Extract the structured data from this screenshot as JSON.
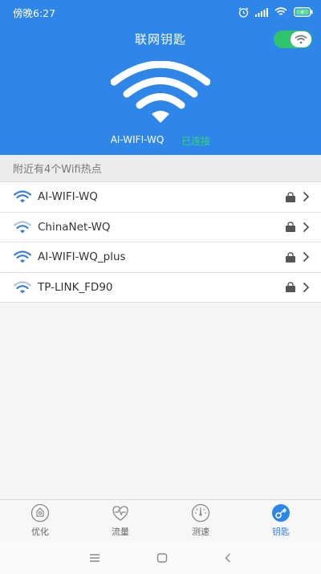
{
  "statusbar": {
    "time": "傍晚6:27"
  },
  "header": {
    "title": "联网钥匙",
    "toggle_on": true,
    "connected_ssid": "AI-WIFI-WQ",
    "connected_status": "已连接"
  },
  "section": {
    "title": "附近有4个Wifi热点"
  },
  "networks": [
    {
      "name": "AI-WIFI-WQ",
      "signal": "strong",
      "locked": true
    },
    {
      "name": "ChinaNet-WQ",
      "signal": "medium",
      "locked": true
    },
    {
      "name": "AI-WIFI-WQ_plus",
      "signal": "strong",
      "locked": true
    },
    {
      "name": "TP-LINK_FD90",
      "signal": "medium",
      "locked": true
    }
  ],
  "bottom_nav": [
    {
      "label": "优化",
      "icon": "optimize-icon",
      "active": false
    },
    {
      "label": "流量",
      "icon": "traffic-icon",
      "active": false
    },
    {
      "label": "测速",
      "icon": "speedometer-icon",
      "active": false
    },
    {
      "label": "钥匙",
      "icon": "key-icon",
      "active": true
    }
  ],
  "colors": {
    "header_bg": "#2e86e8",
    "connected_green": "#35d27e",
    "toggle_green": "#2fc46b",
    "active_tab": "#2e86e8"
  }
}
